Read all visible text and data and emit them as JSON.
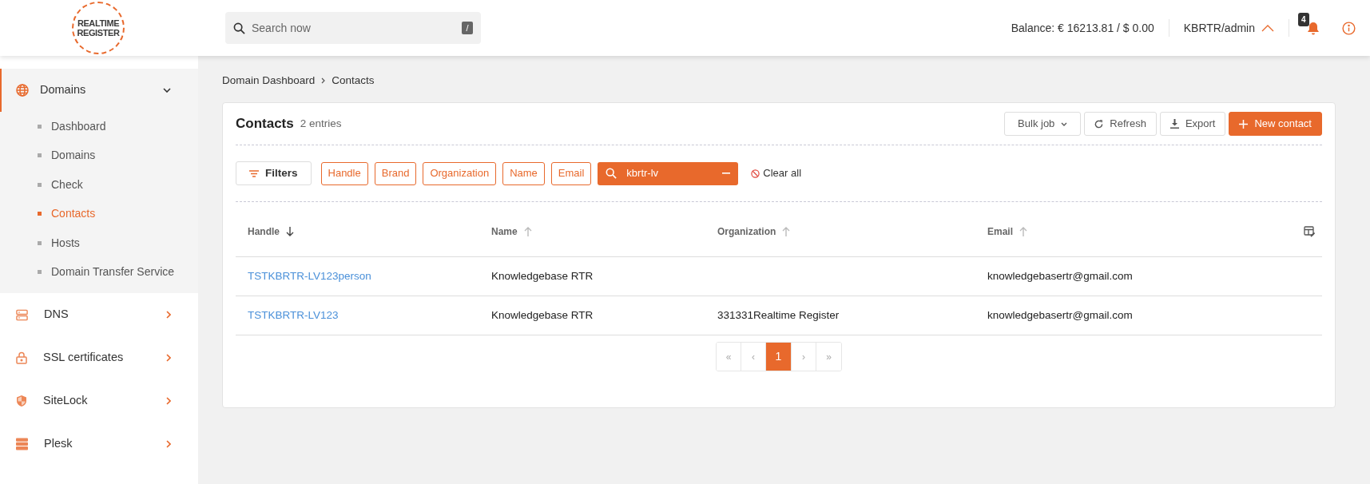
{
  "header": {
    "logo": [
      "REALTIME",
      "REGISTER"
    ],
    "search": {
      "placeholder": "Search now",
      "shortcut": "/"
    },
    "balance": "Balance: € 16213.81 / $ 0.00",
    "user": "KBRTR/admin",
    "notifications": "4"
  },
  "sidebar": {
    "items": [
      {
        "label": "Domains",
        "expanded": true,
        "children": [
          {
            "label": "Dashboard",
            "selected": false
          },
          {
            "label": "Domains",
            "selected": false
          },
          {
            "label": "Check",
            "selected": false
          },
          {
            "label": "Contacts",
            "selected": true
          },
          {
            "label": "Hosts",
            "selected": false
          },
          {
            "label": "Domain Transfer Service",
            "selected": false
          }
        ]
      },
      {
        "label": "DNS",
        "expanded": false
      },
      {
        "label": "SSL certificates",
        "expanded": false
      },
      {
        "label": "SiteLock",
        "expanded": false
      },
      {
        "label": "Plesk",
        "expanded": false
      }
    ]
  },
  "breadcrumb": [
    "Domain Dashboard",
    "Contacts"
  ],
  "card": {
    "title": "Contacts",
    "count": "2 entries",
    "actions": [
      {
        "label": "Bulk job",
        "kind": "dropdown"
      },
      {
        "label": "Refresh",
        "kind": "refresh"
      },
      {
        "label": "Export",
        "kind": "export"
      },
      {
        "label": "New contact",
        "kind": "primary"
      }
    ],
    "filters_button": "Filters",
    "filters": [
      {
        "kind": "chip",
        "label": "Handle"
      },
      {
        "kind": "chip",
        "label": "Brand"
      },
      {
        "kind": "chip",
        "label": "Organization"
      },
      {
        "kind": "chip",
        "label": "Name"
      },
      {
        "kind": "chip",
        "label": "Email"
      },
      {
        "kind": "search",
        "value": "kbrtr-lv"
      }
    ],
    "clear_all": "Clear all"
  },
  "table": {
    "columns": [
      {
        "label": "Handle",
        "sorted": true
      },
      {
        "label": "Name",
        "sorted": false
      },
      {
        "label": "Organization",
        "sorted": false
      },
      {
        "label": "Email",
        "sorted": false
      }
    ],
    "rows": [
      [
        "TSTKBRTR-LV123person",
        "Knowledgebase RTR",
        "",
        "knowledgebasertr@gmail.com"
      ],
      [
        "TSTKBRTR-LV123",
        "Knowledgebase RTR",
        "331331Realtime Register",
        "knowledgebasertr@gmail.com"
      ]
    ]
  },
  "pagination": [
    {
      "label": "«",
      "kind": "first",
      "selected": false
    },
    {
      "label": "‹",
      "kind": "prev",
      "selected": false
    },
    {
      "label": "1",
      "kind": "page",
      "selected": true
    },
    {
      "label": "›",
      "kind": "next",
      "selected": false
    },
    {
      "label": "»",
      "kind": "last",
      "selected": false
    }
  ]
}
